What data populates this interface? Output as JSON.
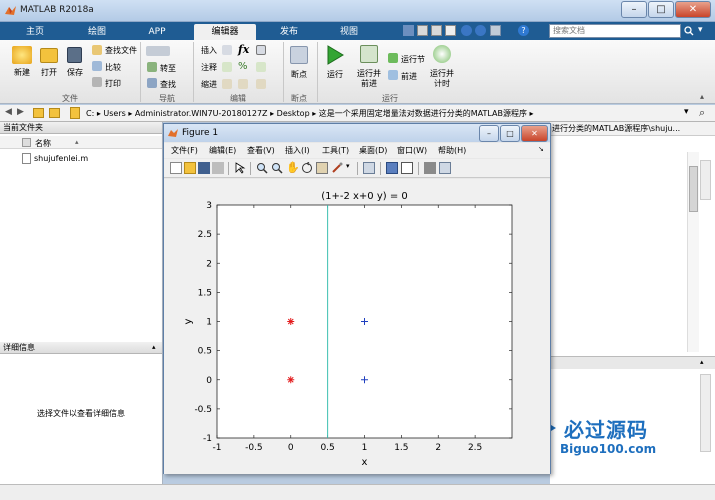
{
  "app": {
    "title": "MATLAB R2018a"
  },
  "window_buttons": {
    "minimize": "–",
    "maximize": "□",
    "close": "✕"
  },
  "ribbon_tabs": [
    "主页",
    "绘图",
    "APP",
    "编辑器",
    "发布",
    "视图"
  ],
  "search": {
    "placeholder": "搜索文档"
  },
  "ribbon": {
    "file": {
      "new": "新建",
      "open": "打开",
      "save": "保存",
      "find_files": "查找文件",
      "compare": "比较",
      "print": "打印",
      "group": "文件"
    },
    "nav": {
      "goto": "转至",
      "find": "查找",
      "group": "导航"
    },
    "edit": {
      "insert": "插入",
      "comment": "注释",
      "indent": "缩进",
      "fx": "fx",
      "group": "编辑"
    },
    "breakpoints": {
      "label": "断点",
      "group": "断点"
    },
    "run": {
      "run": "运行",
      "run_advance_1": "运行并",
      "run_advance_2": "前进",
      "run_section": "运行节",
      "advance": "前进",
      "run_time_1": "运行并",
      "run_time_2": "计时",
      "group": "运行"
    }
  },
  "address": {
    "parts": [
      "C:",
      "Users",
      "Administrator.WIN7U-20180127Z",
      "Desktop",
      "这是一个采用固定增量法对数据进行分类的MATLAB源程序"
    ]
  },
  "left_panel": {
    "title": "当前文件夹",
    "col_name": "名称",
    "files": [
      "shujufenlei.m"
    ],
    "details_title": "详细信息",
    "details_msg": "选择文件以查看详细信息"
  },
  "right_panel": {
    "path_fragment": "进行分类的MATLAB源程序\\shuju..."
  },
  "figure": {
    "title": "Figure 1",
    "menus": [
      "文件(F)",
      "编辑(E)",
      "查看(V)",
      "插入(I)",
      "工具(T)",
      "桌面(D)",
      "窗口(W)",
      "帮助(H)"
    ]
  },
  "watermark": {
    "text": "必过源码",
    "url": "Biguo100.com"
  },
  "chart_data": {
    "type": "scatter",
    "title": "(1+-2 x+0 y) = 0",
    "xlabel": "x",
    "ylabel": "y",
    "xlim": [
      -1,
      3
    ],
    "ylim": [
      -1,
      3
    ],
    "xticks": [
      -1,
      -0.5,
      0,
      0.5,
      1,
      1.5,
      2,
      2.5
    ],
    "yticks": [
      -1,
      -0.5,
      0,
      0.5,
      1,
      1.5,
      2,
      2.5,
      3
    ],
    "tick_labels_x": [
      "-1",
      "-0.5",
      "0",
      "0.5",
      "1",
      "1.5",
      "2",
      "2.5"
    ],
    "tick_labels_y": [
      "-1",
      "-0.5",
      "0",
      "0.5",
      "1",
      "1.5",
      "2",
      "2.5",
      "3"
    ],
    "grid": false,
    "series": [
      {
        "marker": "*",
        "color": "#e31a1c",
        "points": [
          [
            0,
            1
          ],
          [
            0,
            0
          ]
        ]
      },
      {
        "marker": "+",
        "color": "#1f3fbf",
        "points": [
          [
            1,
            1
          ],
          [
            1,
            0
          ]
        ]
      }
    ],
    "lines": [
      {
        "x": 0.5,
        "color": "#3cbfb0"
      }
    ]
  }
}
